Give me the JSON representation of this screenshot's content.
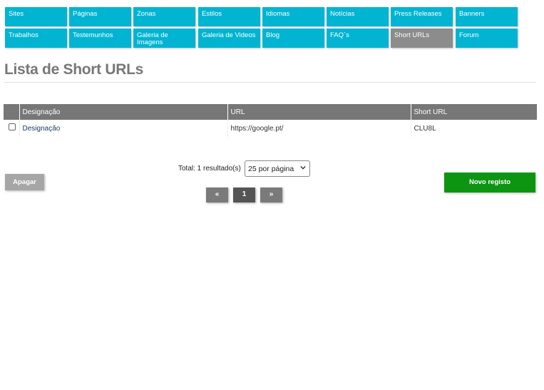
{
  "nav": {
    "items": [
      {
        "label": "Sites"
      },
      {
        "label": "Páginas"
      },
      {
        "label": "Zonas"
      },
      {
        "label": "Estilos"
      },
      {
        "label": "Idiomas"
      },
      {
        "label": "Notícias"
      },
      {
        "label": "Press Releases"
      },
      {
        "label": "Banners"
      },
      {
        "label": "Trabalhos"
      },
      {
        "label": "Testemunhos"
      },
      {
        "label": "Galeria de Imagens"
      },
      {
        "label": "Galeria de Videos"
      },
      {
        "label": "Blog"
      },
      {
        "label": "FAQ´s"
      },
      {
        "label": "Short URLs",
        "active": true
      },
      {
        "label": "Forum"
      }
    ]
  },
  "page": {
    "title": "Lista de Short URLs"
  },
  "table": {
    "headers": [
      "Designação",
      "URL",
      "Short URL"
    ],
    "rows": [
      {
        "designacao": "Designação",
        "url": "https://google.pt/",
        "short_url": "CLU8L"
      }
    ]
  },
  "footer": {
    "total": "Total: 1 resultado(s)",
    "per_page": "25 por página",
    "delete_label": "Apagar",
    "new_label": "Novo registo",
    "pagination": {
      "prev": "«",
      "current": "1",
      "next": "»"
    }
  },
  "colors": {
    "nav": "#00b4d2",
    "nav_active": "#8c8c8c",
    "new_button": "#0d9512",
    "header": "#777777"
  }
}
